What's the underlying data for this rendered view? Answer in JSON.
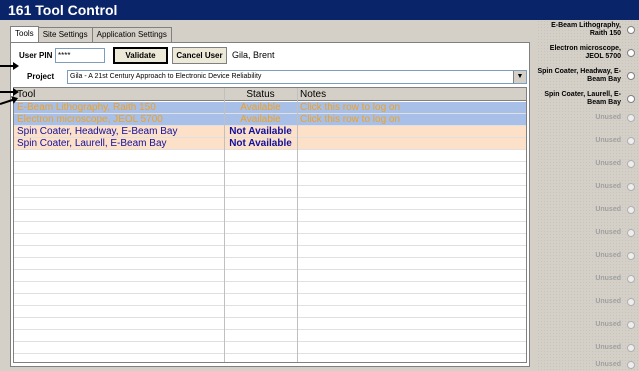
{
  "window": {
    "title": "161 Tool Control"
  },
  "tabs": [
    {
      "label": "Tools",
      "active": true
    },
    {
      "label": "Site Settings",
      "active": false
    },
    {
      "label": "Application Settings",
      "active": false
    }
  ],
  "login": {
    "pin_label": "User PIN",
    "pin_value": "****",
    "validate_label": "Validate",
    "cancel_label": "Cancel User",
    "user_name": "Gila, Brent"
  },
  "project": {
    "label": "Project",
    "selected": "Gila - A 21st Century Approach to Electronic Device Reliability"
  },
  "grid": {
    "columns": [
      "Tool",
      "Status",
      "Notes"
    ],
    "rows": [
      {
        "tool": "E-Beam Lithography, Raith 150",
        "status": "Available",
        "notes": "Click this row to log on",
        "style": "blue"
      },
      {
        "tool": "Electron microscope, JEOL 5700",
        "status": "Available",
        "notes": "Click this row to log on",
        "style": "blue"
      },
      {
        "tool": "Spin Coater, Headway, E-Beam Bay",
        "status": "Not Available",
        "notes": "",
        "style": "peach"
      },
      {
        "tool": "Spin Coater, Laurell, E-Beam Bay",
        "status": "Not Available",
        "notes": "",
        "style": "peach"
      }
    ]
  },
  "right_panel": {
    "items": [
      {
        "label": "E-Beam Lithography, Raith 150",
        "active": true
      },
      {
        "label": "Electron microscope, JEOL 5700",
        "active": true
      },
      {
        "label": "Spin Coater, Headway, E-Beam Bay",
        "active": true
      },
      {
        "label": "Spin Coater, Laurell, E-Beam Bay",
        "active": true
      },
      {
        "label": "Unused",
        "active": false
      },
      {
        "label": "Unused",
        "active": false
      },
      {
        "label": "Unused",
        "active": false
      },
      {
        "label": "Unused",
        "active": false
      },
      {
        "label": "Unused",
        "active": false
      },
      {
        "label": "Unused",
        "active": false
      },
      {
        "label": "Unused",
        "active": false
      },
      {
        "label": "Unused",
        "active": false
      },
      {
        "label": "Unused",
        "active": false
      },
      {
        "label": "Unused",
        "active": false
      },
      {
        "label": "Unused",
        "active": false
      },
      {
        "label": "Unused",
        "active": false
      }
    ]
  },
  "colors": {
    "titlebar": "#0a246a",
    "row_available": "#a8c0e8",
    "row_unavailable": "#fde0c8",
    "text_available": "#f0a020",
    "text_unavailable": "#1010a0"
  }
}
